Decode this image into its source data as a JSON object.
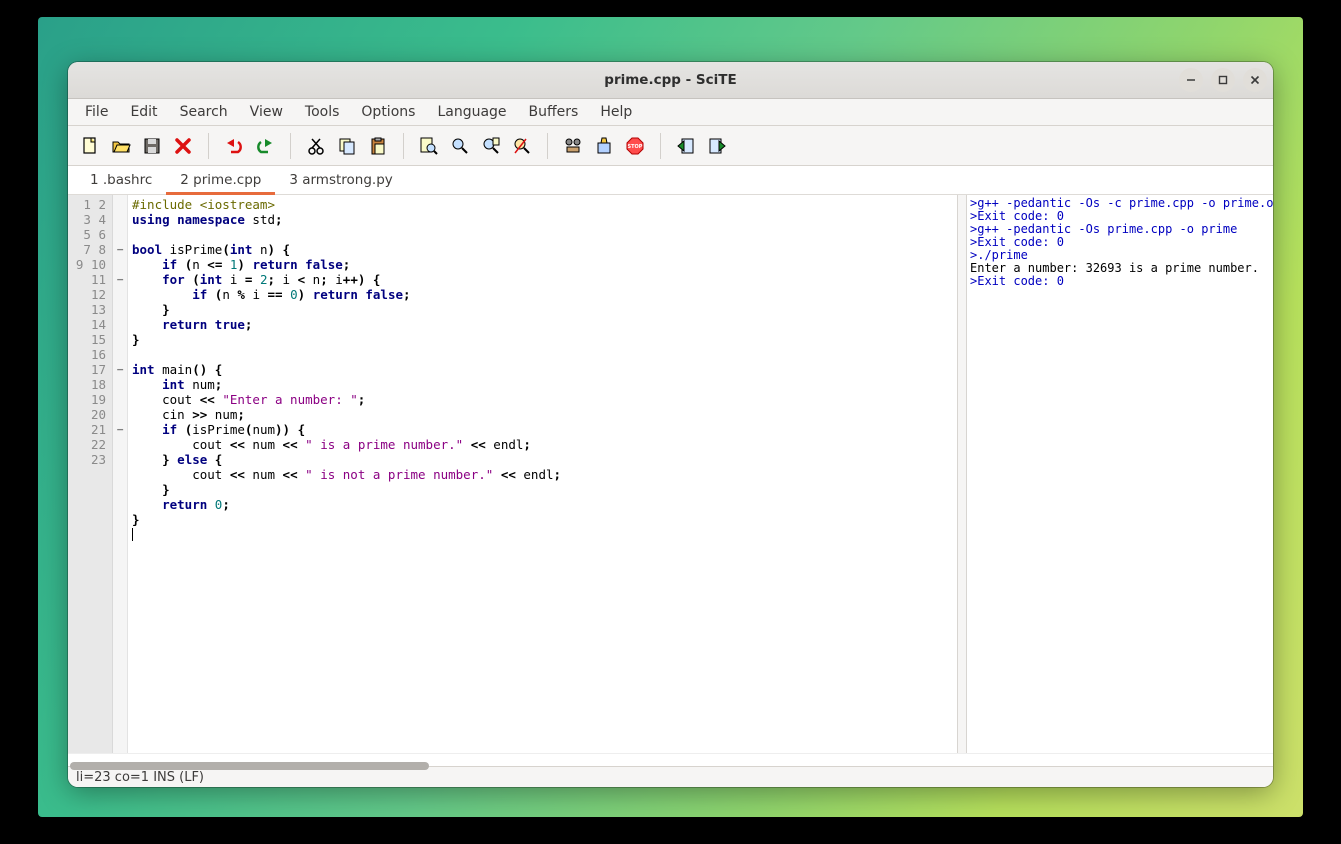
{
  "window": {
    "title": "prime.cpp - SciTE"
  },
  "menu": {
    "items": [
      "File",
      "Edit",
      "Search",
      "View",
      "Tools",
      "Options",
      "Language",
      "Buffers",
      "Help"
    ]
  },
  "tabs": [
    {
      "label": "1 .bashrc",
      "active": false
    },
    {
      "label": "2 prime.cpp",
      "active": true
    },
    {
      "label": "3 armstrong.py",
      "active": false
    }
  ],
  "toolbar_icons": [
    "new",
    "open",
    "save",
    "close",
    "undo",
    "redo",
    "cut",
    "copy",
    "paste",
    "find",
    "findnext",
    "findfiles",
    "replace",
    "goto",
    "compile",
    "stop",
    "prev",
    "next"
  ],
  "editor": {
    "line_count": 23,
    "fold_markers": {
      "4": "-",
      "6": "-",
      "12": "-",
      "16": "-"
    },
    "code_tokens": [
      [
        [
          "pre",
          "#include <iostream>"
        ]
      ],
      [
        [
          "kw",
          "using namespace"
        ],
        [
          "",
          " std"
        ],
        [
          "op",
          ";"
        ]
      ],
      [
        [
          "",
          ""
        ]
      ],
      [
        [
          "kw",
          "bool"
        ],
        [
          "",
          " isPrime"
        ],
        [
          "op",
          "("
        ],
        [
          "kw",
          "int"
        ],
        [
          "",
          " n"
        ],
        [
          "op",
          ") {"
        ]
      ],
      [
        [
          "",
          "    "
        ],
        [
          "kw",
          "if"
        ],
        [
          "op",
          " ("
        ],
        [
          "",
          "n "
        ],
        [
          "op",
          "<= "
        ],
        [
          "num",
          "1"
        ],
        [
          "op",
          ") "
        ],
        [
          "kw",
          "return false"
        ],
        [
          "op",
          ";"
        ]
      ],
      [
        [
          "",
          "    "
        ],
        [
          "kw",
          "for"
        ],
        [
          "op",
          " ("
        ],
        [
          "kw",
          "int"
        ],
        [
          "",
          " i "
        ],
        [
          "op",
          "= "
        ],
        [
          "num",
          "2"
        ],
        [
          "op",
          ";"
        ],
        [
          "",
          " i "
        ],
        [
          "op",
          "<"
        ],
        [
          "",
          " n"
        ],
        [
          "op",
          ";"
        ],
        [
          "",
          " i"
        ],
        [
          "op",
          "++) {"
        ]
      ],
      [
        [
          "",
          "        "
        ],
        [
          "kw",
          "if"
        ],
        [
          "op",
          " ("
        ],
        [
          "",
          "n "
        ],
        [
          "op",
          "%"
        ],
        [
          "",
          " i "
        ],
        [
          "op",
          "== "
        ],
        [
          "num",
          "0"
        ],
        [
          "op",
          ") "
        ],
        [
          "kw",
          "return false"
        ],
        [
          "op",
          ";"
        ]
      ],
      [
        [
          "",
          "    "
        ],
        [
          "op",
          "}"
        ]
      ],
      [
        [
          "",
          "    "
        ],
        [
          "kw",
          "return true"
        ],
        [
          "op",
          ";"
        ]
      ],
      [
        [
          "op",
          "}"
        ]
      ],
      [
        [
          "",
          ""
        ]
      ],
      [
        [
          "kw",
          "int"
        ],
        [
          "",
          " main"
        ],
        [
          "op",
          "() {"
        ]
      ],
      [
        [
          "",
          "    "
        ],
        [
          "kw",
          "int"
        ],
        [
          "",
          " num"
        ],
        [
          "op",
          ";"
        ]
      ],
      [
        [
          "",
          "    cout "
        ],
        [
          "op",
          "<<"
        ],
        [
          "",
          " "
        ],
        [
          "str",
          "\"Enter a number: \""
        ],
        [
          "op",
          ";"
        ]
      ],
      [
        [
          "",
          "    cin "
        ],
        [
          "op",
          ">>"
        ],
        [
          "",
          " num"
        ],
        [
          "op",
          ";"
        ]
      ],
      [
        [
          "",
          "    "
        ],
        [
          "kw",
          "if"
        ],
        [
          "op",
          " ("
        ],
        [
          "",
          "isPrime"
        ],
        [
          "op",
          "("
        ],
        [
          "",
          "num"
        ],
        [
          "op",
          ")) {"
        ]
      ],
      [
        [
          "",
          "        cout "
        ],
        [
          "op",
          "<<"
        ],
        [
          "",
          " num "
        ],
        [
          "op",
          "<<"
        ],
        [
          "",
          " "
        ],
        [
          "str",
          "\" is a prime number.\""
        ],
        [
          "op",
          " <<"
        ],
        [
          "",
          " endl"
        ],
        [
          "op",
          ";"
        ]
      ],
      [
        [
          "",
          "    "
        ],
        [
          "op",
          "} "
        ],
        [
          "kw",
          "else"
        ],
        [
          "op",
          " {"
        ]
      ],
      [
        [
          "",
          "        cout "
        ],
        [
          "op",
          "<<"
        ],
        [
          "",
          " num "
        ],
        [
          "op",
          "<<"
        ],
        [
          "",
          " "
        ],
        [
          "str",
          "\" is not a prime number.\""
        ],
        [
          "op",
          " <<"
        ],
        [
          "",
          " endl"
        ],
        [
          "op",
          ";"
        ]
      ],
      [
        [
          "",
          "    "
        ],
        [
          "op",
          "}"
        ]
      ],
      [
        [
          "",
          "    "
        ],
        [
          "kw",
          "return"
        ],
        [
          "",
          " "
        ],
        [
          "num",
          "0"
        ],
        [
          "op",
          ";"
        ]
      ],
      [
        [
          "op",
          "}"
        ]
      ],
      [
        [
          "",
          ""
        ]
      ]
    ]
  },
  "output": [
    {
      "cls": "out-cmd",
      "text": ">g++ -pedantic -Os -c prime.cpp -o prime.o"
    },
    {
      "cls": "out-cmd",
      "text": ">Exit code: 0"
    },
    {
      "cls": "out-cmd",
      "text": ">g++ -pedantic -Os prime.cpp -o prime"
    },
    {
      "cls": "out-cmd",
      "text": ">Exit code: 0"
    },
    {
      "cls": "out-cmd",
      "text": ">./prime"
    },
    {
      "cls": "",
      "text": "Enter a number: 32693 is a prime number."
    },
    {
      "cls": "out-cmd",
      "text": ">Exit code: 0"
    }
  ],
  "status": {
    "text": "li=23 co=1 INS (LF)"
  }
}
